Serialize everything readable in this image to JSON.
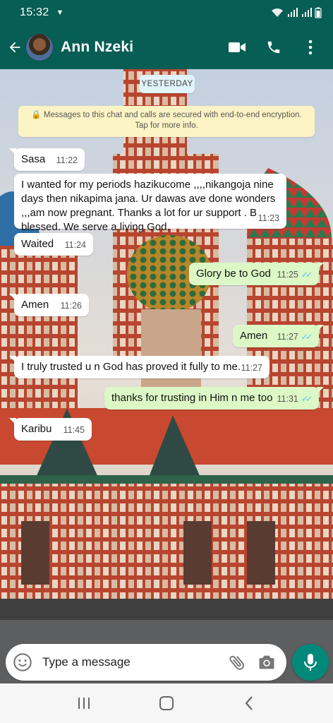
{
  "status_bar": {
    "time": "15:32"
  },
  "header": {
    "contact_name": "Ann Nzeki"
  },
  "chat": {
    "date_chip": "YESTERDAY",
    "encryption_notice": "Messages to this chat and calls are secured with end-to-end encryption. Tap for more info.",
    "messages": [
      {
        "direction": "in",
        "text": "Sasa",
        "time": "11:22"
      },
      {
        "direction": "in",
        "text": "I wanted for my periods hazikucome ,,,,nikangoja nine days  then nikapima jana. Ur dawas ave done wonders ,,,am now pregnant. Thanks a lot for ur support . B blessed. We serve a living God.",
        "time": "11:23"
      },
      {
        "direction": "in",
        "text": "Waited",
        "time": "11:24"
      },
      {
        "direction": "out",
        "text": "Glory be to God",
        "time": "11:25",
        "status": "read"
      },
      {
        "direction": "in",
        "text": "Amen",
        "time": "11:26"
      },
      {
        "direction": "out",
        "text": "Amen",
        "time": "11:27",
        "status": "read"
      },
      {
        "direction": "in",
        "text": "I truly trusted u n God has proved it fully to me.",
        "time": "11:27"
      },
      {
        "direction": "out",
        "text": "thanks for trusting in Him n me too",
        "time": "11:31",
        "status": "read"
      },
      {
        "direction": "in",
        "text": "Karibu",
        "time": "11:45"
      }
    ]
  },
  "input": {
    "placeholder": "Type a message"
  },
  "colors": {
    "header": "#075e54",
    "outgoing_bubble": "#dcf8c6",
    "incoming_bubble": "#ffffff",
    "mic_button": "#00897b",
    "read_ticks": "#4fc3f7"
  },
  "icons": [
    "back-arrow-icon",
    "video-call-icon",
    "phone-icon",
    "more-options-icon",
    "emoji-icon",
    "attach-icon",
    "camera-icon",
    "mic-icon",
    "recents-icon",
    "home-icon",
    "back-icon"
  ]
}
